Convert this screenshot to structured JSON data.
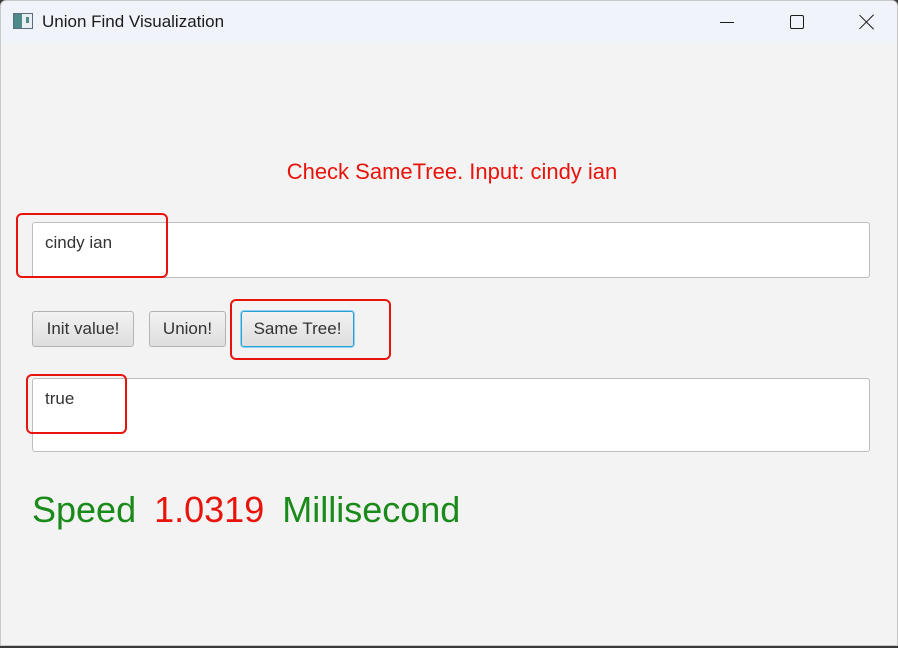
{
  "window": {
    "title": "Union Find Visualization"
  },
  "icons": {
    "app": "app-icon",
    "minimize": "minimize-icon",
    "maximize": "maximize-icon",
    "close": "close-icon"
  },
  "prompt_text": "Check SameTree. Input: cindy ian",
  "input": {
    "value": "cindy ian"
  },
  "buttons": {
    "init_label": "Init value!",
    "union_label": "Union!",
    "same_tree_label": "Same Tree!"
  },
  "result": {
    "value": "true"
  },
  "speed": {
    "label": "Speed",
    "value": "1.0319",
    "unit": "Millisecond"
  },
  "colors": {
    "prompt": "#e8140c",
    "speed_label": "#1a8a1a",
    "speed_value": "#e8140c",
    "annotation": "#e8140c",
    "focus_border": "#2a9fd8"
  }
}
